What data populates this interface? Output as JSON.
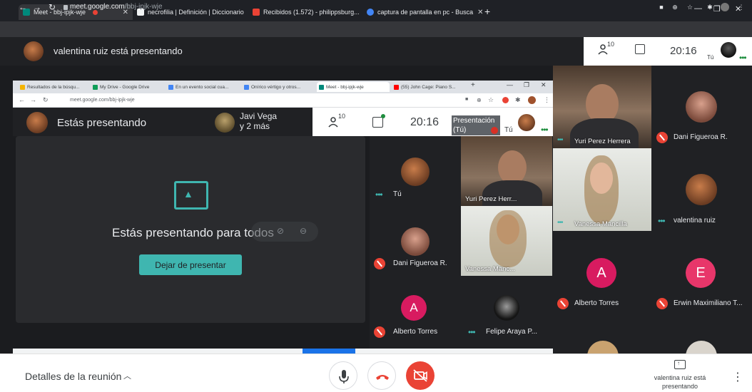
{
  "browser": {
    "tabs": [
      {
        "label": "Meet - bbj-ipjk-wje",
        "active": true
      },
      {
        "label": "necrofilia | Definición | Diccionario"
      },
      {
        "label": "Recibidos (1.572) - philippsburg..."
      },
      {
        "label": "captura de pantalla en pc - Busca"
      }
    ],
    "url_host": "meet.google.com",
    "url_path": "/bbj-ipjk-wje"
  },
  "meeting": {
    "presenter_text": "valentina ruiz está presentando",
    "participant_count": "10",
    "time": "20:16",
    "self_label": "Tú"
  },
  "inner": {
    "tabs": [
      {
        "label": "Resultados de la búsqu..."
      },
      {
        "label": "My Drive - Google Drive"
      },
      {
        "label": "En un evento social cua..."
      },
      {
        "label": "Onírico vértigo y otros..."
      },
      {
        "label": "Meet - bbj-ipjk-wje",
        "active": true
      },
      {
        "label": "(55) John Cage: Piano S..."
      }
    ],
    "url": "meet.google.com/bbj-ipjk-wje",
    "header_presenting": "Estás presentando",
    "javi_name": "Javi Vega",
    "javi_more": "y 2 más",
    "participant_count": "10",
    "time": "20:16",
    "presentation_label": "Presentación (Tú)",
    "self_label": "Tú",
    "presenting_message": "Estás presentando para todos",
    "stop_button": "Dejar de presentar",
    "tiles": [
      {
        "name": "Tú"
      },
      {
        "name": "Yuri Perez Herr..."
      },
      {
        "name": "Dani Figueroa R."
      },
      {
        "name": "Vanessa Manc..."
      },
      {
        "name": "Alberto Torres",
        "initial": "A"
      },
      {
        "name": "Felipe Araya P..."
      }
    ]
  },
  "grid": {
    "tiles": [
      {
        "name": "Yuri Perez Herrera"
      },
      {
        "name": "Dani Figueroa R."
      },
      {
        "name": "Vanessa Mancilla"
      },
      {
        "name": "valentina ruiz"
      },
      {
        "name": "Alberto Torres",
        "initial": "A"
      },
      {
        "name": "Erwin Maximiliano T..."
      }
    ]
  },
  "bottom": {
    "details_label": "Detalles de la reunión",
    "presenter_status": "valentina ruiz está presentando"
  },
  "colors": {
    "accent_teal": "#3fb6b0",
    "alert_red": "#ea4335",
    "avatar_pink": "#d81b60",
    "avatar_pink2": "#e8366a",
    "meet_dark": "#202124"
  }
}
